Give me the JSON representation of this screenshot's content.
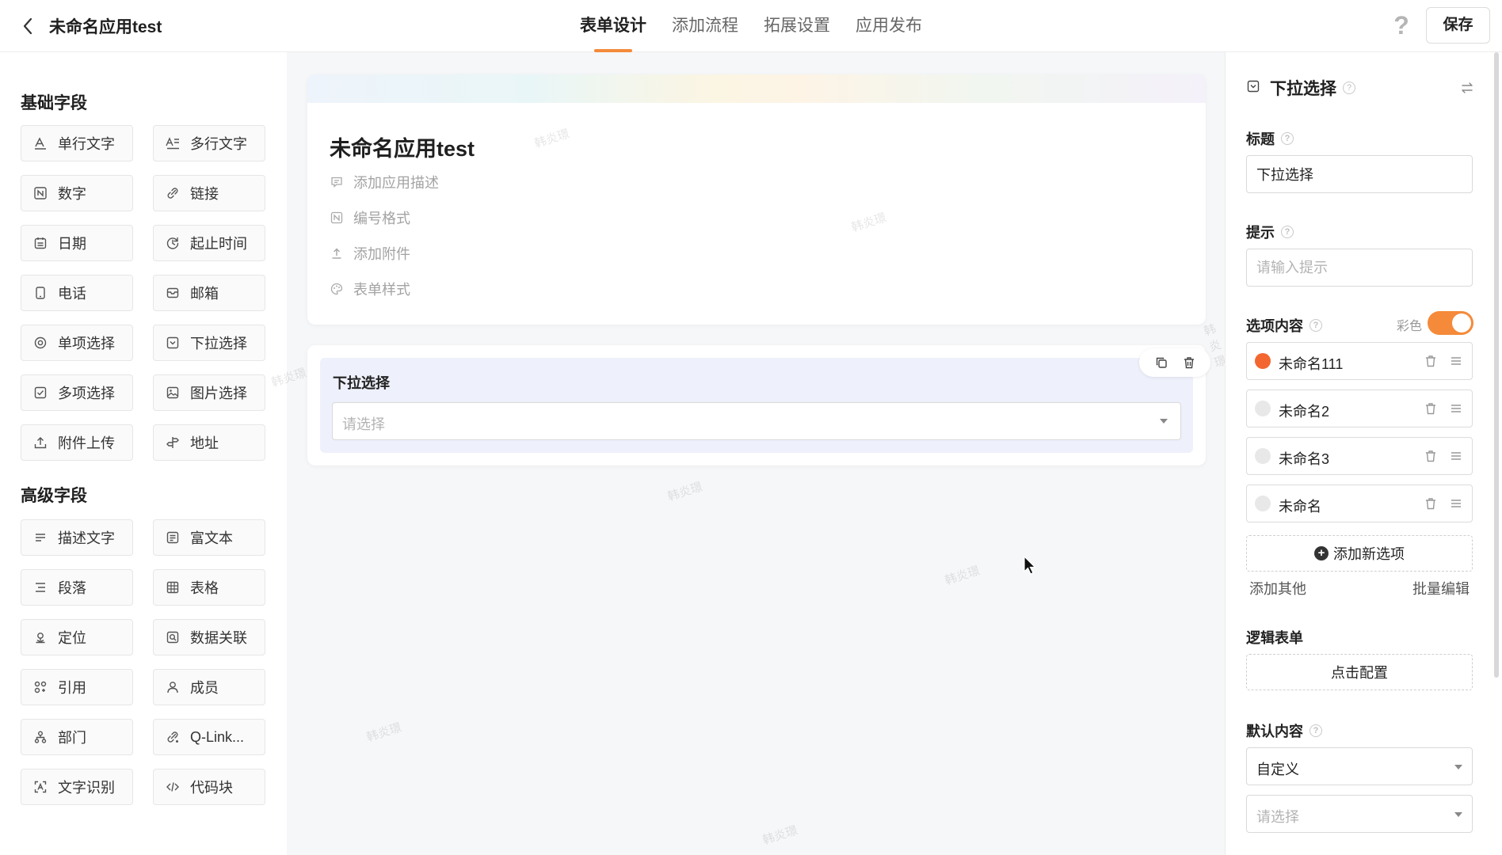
{
  "header": {
    "app_title": "未命名应用test",
    "tabs": [
      "表单设计",
      "添加流程",
      "拓展设置",
      "应用发布"
    ],
    "active_tab": "表单设计",
    "help_label": "?",
    "save_label": "保存",
    "accent_color": "#f48a3a"
  },
  "left_panel": {
    "basic_title": "基础字段",
    "basic_fields": [
      {
        "label": "单行文字",
        "icon": "single-line-text-icon"
      },
      {
        "label": "多行文字",
        "icon": "multi-line-text-icon"
      },
      {
        "label": "数字",
        "icon": "number-icon"
      },
      {
        "label": "链接",
        "icon": "link-icon"
      },
      {
        "label": "日期",
        "icon": "calendar-icon"
      },
      {
        "label": "起止时间",
        "icon": "time-range-icon"
      },
      {
        "label": "电话",
        "icon": "phone-icon"
      },
      {
        "label": "邮箱",
        "icon": "mail-icon"
      },
      {
        "label": "单项选择",
        "icon": "radio-icon"
      },
      {
        "label": "下拉选择",
        "icon": "dropdown-icon"
      },
      {
        "label": "多项选择",
        "icon": "checkbox-icon"
      },
      {
        "label": "图片选择",
        "icon": "image-icon"
      },
      {
        "label": "附件上传",
        "icon": "upload-icon"
      },
      {
        "label": "地址",
        "icon": "signpost-icon"
      }
    ],
    "advanced_title": "高级字段",
    "advanced_fields": [
      {
        "label": "描述文字",
        "icon": "description-icon"
      },
      {
        "label": "富文本",
        "icon": "rich-text-icon"
      },
      {
        "label": "段落",
        "icon": "paragraph-icon"
      },
      {
        "label": "表格",
        "icon": "table-icon"
      },
      {
        "label": "定位",
        "icon": "location-icon"
      },
      {
        "label": "数据关联",
        "icon": "data-link-icon"
      },
      {
        "label": "引用",
        "icon": "reference-icon"
      },
      {
        "label": "成员",
        "icon": "member-icon"
      },
      {
        "label": "部门",
        "icon": "department-icon"
      },
      {
        "label": "Q-Link...",
        "icon": "qlink-icon"
      },
      {
        "label": "文字识别",
        "icon": "ocr-icon"
      },
      {
        "label": "代码块",
        "icon": "code-icon"
      }
    ]
  },
  "canvas": {
    "form_title": "未命名应用test",
    "meta_items": [
      {
        "label": "添加应用描述",
        "icon": "comment-icon"
      },
      {
        "label": "编号格式",
        "icon": "number-format-icon"
      },
      {
        "label": "添加附件",
        "icon": "attach-upload-icon"
      },
      {
        "label": "表单样式",
        "icon": "palette-icon"
      }
    ],
    "field": {
      "label": "下拉选择",
      "placeholder": "请选择"
    },
    "watermark_text": "韩炎璟"
  },
  "right_panel": {
    "title": "下拉选择",
    "title_label": "标题",
    "title_value": "下拉选择",
    "hint_label": "提示",
    "hint_placeholder": "请输入提示",
    "options_label": "选项内容",
    "color_label": "彩色",
    "color_enabled": true,
    "options": [
      {
        "name": "未命名111",
        "color": "#f4662f"
      },
      {
        "name": "未命名2",
        "color": "#e8e8e8"
      },
      {
        "name": "未命名3",
        "color": "#e8e8e8"
      },
      {
        "name": "未命名",
        "color": "#e8e8e8"
      }
    ],
    "add_option_label": "添加新选项",
    "add_other_label": "添加其他",
    "batch_edit_label": "批量编辑",
    "logic_label": "逻辑表单",
    "logic_button": "点击配置",
    "default_label": "默认内容",
    "default_mode": "自定义",
    "default_placeholder": "请选择"
  }
}
